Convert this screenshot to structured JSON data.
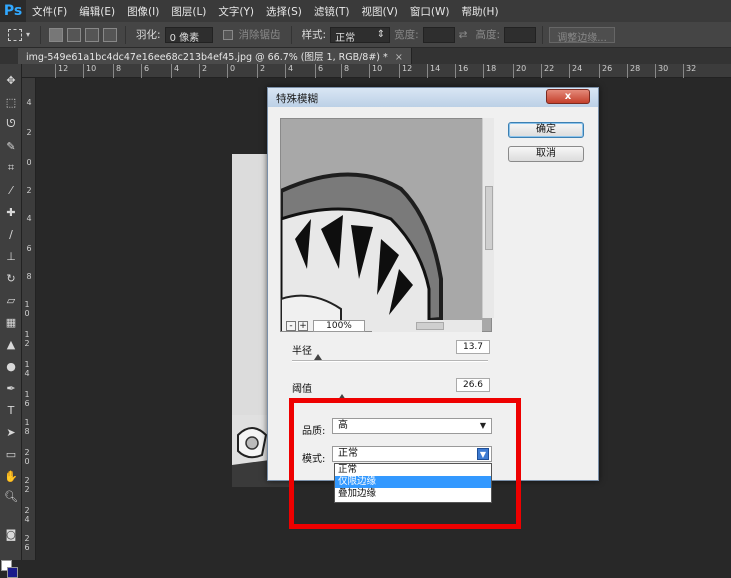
{
  "menubar": {
    "logo": "Ps",
    "items": [
      "文件(F)",
      "编辑(E)",
      "图像(I)",
      "图层(L)",
      "文字(Y)",
      "选择(S)",
      "滤镜(T)",
      "视图(V)",
      "窗口(W)",
      "帮助(H)"
    ]
  },
  "options": {
    "feather_label": "羽化:",
    "feather_value": "0 像素",
    "antialias_label": "消除锯齿",
    "style_label": "样式:",
    "style_value": "正常",
    "width_label": "宽度:",
    "height_label": "高度:",
    "refine_button": "调整边缘..."
  },
  "tab": {
    "title": "img-549e61a1bc4dc47e16ee68c213b4ef45.jpg @ 66.7% (图层 1, RGB/8#) *",
    "close": "×"
  },
  "ruler_top": [
    "12",
    "10",
    "8",
    "6",
    "4",
    "2",
    "0",
    "2",
    "4",
    "6",
    "8",
    "10",
    "12",
    "14",
    "16",
    "18",
    "20",
    "22",
    "24",
    "26",
    "28",
    "30",
    "32"
  ],
  "ruler_left": [
    "4",
    "2",
    "0",
    "2",
    "4",
    "6",
    "8",
    "1 0",
    "1 2",
    "1 4",
    "1 6",
    "1 8",
    "2 0",
    "2 2",
    "2 4",
    "2 6"
  ],
  "dialog": {
    "title": "特殊模糊",
    "close": "x",
    "ok": "确定",
    "cancel": "取消",
    "zoom_minus": "-",
    "zoom_plus": "+",
    "zoom_value": "100%",
    "radius_label": "半径",
    "radius_value": "13.7",
    "threshold_label": "阈值",
    "threshold_value": "26.6",
    "quality_label": "品质:",
    "quality_value": "高",
    "mode_label": "模式:",
    "mode_value": "正常",
    "mode_options": [
      "正常",
      "仅限边缘",
      "叠加边缘"
    ],
    "mode_selected_index": 1
  },
  "colors": {
    "highlight": "#ee0000",
    "foreground": "#ffffff",
    "background": "#1a1a8a"
  }
}
